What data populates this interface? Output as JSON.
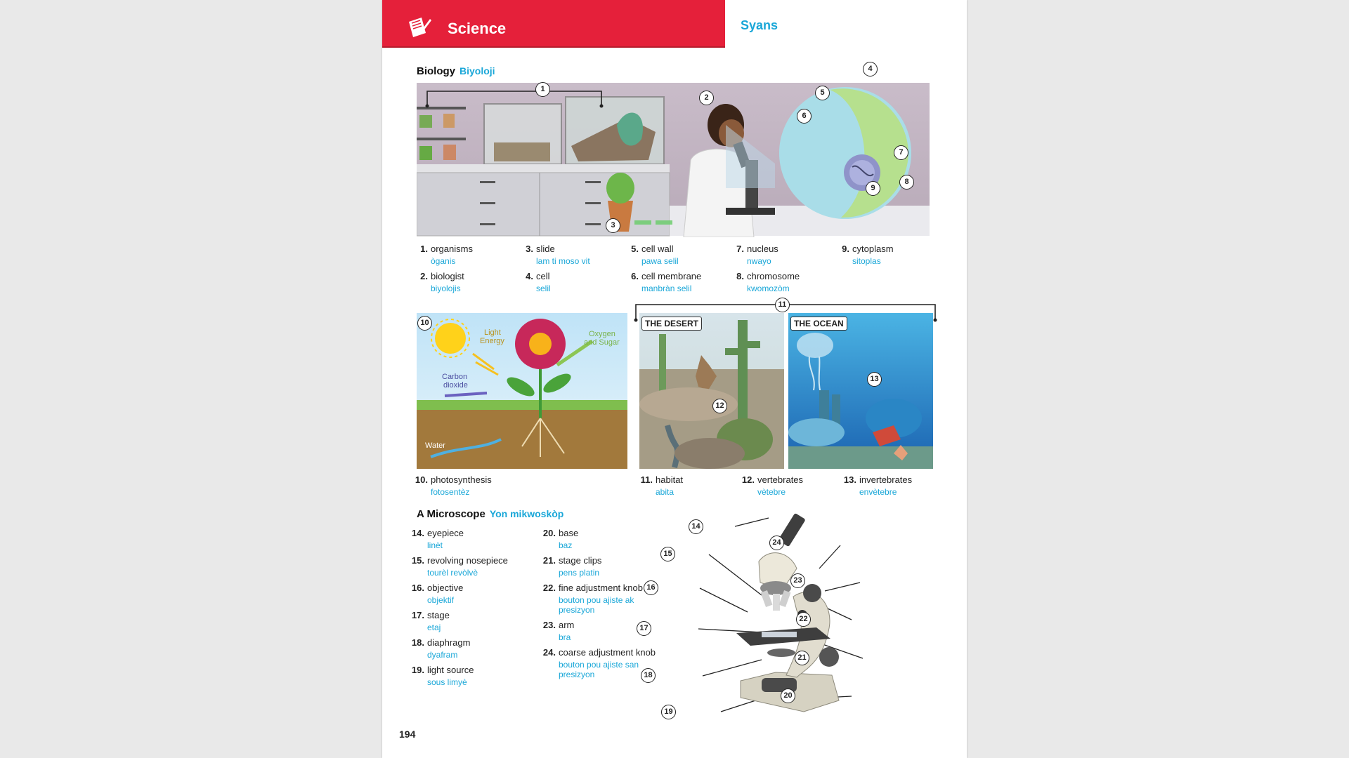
{
  "header": {
    "title": "Science",
    "subtitle": "Syans"
  },
  "biology": {
    "title": "Biology",
    "title_ht": "Biyoloji",
    "items": [
      {
        "num": "1.",
        "en": "organisms",
        "ht": "òganis"
      },
      {
        "num": "2.",
        "en": "biologist",
        "ht": "biyolojis"
      },
      {
        "num": "3.",
        "en": "slide",
        "ht": "lam ti moso vit"
      },
      {
        "num": "4.",
        "en": "cell",
        "ht": "selil"
      },
      {
        "num": "5.",
        "en": "cell wall",
        "ht": "pawa selil"
      },
      {
        "num": "6.",
        "en": "cell membrane",
        "ht": "manbràn selil"
      },
      {
        "num": "7.",
        "en": "nucleus",
        "ht": "nwayo"
      },
      {
        "num": "8.",
        "en": "chromosome",
        "ht": "kwomozòm"
      },
      {
        "num": "9.",
        "en": "cytoplasm",
        "ht": "sitoplas"
      }
    ]
  },
  "ecology": {
    "items": [
      {
        "num": "10.",
        "en": "photosynthesis",
        "ht": "fotosentèz"
      },
      {
        "num": "11.",
        "en": "habitat",
        "ht": "abita"
      },
      {
        "num": "12.",
        "en": "vertebrates",
        "ht": "vètebre"
      },
      {
        "num": "13.",
        "en": "invertebrates",
        "ht": "envètebre"
      }
    ],
    "photo_labels": {
      "light": "Light Energy",
      "oxygen": "Oxygen and Sugar",
      "carbon": "Carbon dioxide",
      "water": "Water"
    },
    "desert_label": "THE DESERT",
    "ocean_label": "THE OCEAN"
  },
  "microscope": {
    "title": "A Microscope",
    "title_ht": "Yon mikwoskòp",
    "items": [
      {
        "num": "14.",
        "en": "eyepiece",
        "ht": "linèt"
      },
      {
        "num": "15.",
        "en": "revolving nosepiece",
        "ht": "tourèl revòlvè"
      },
      {
        "num": "16.",
        "en": "objective",
        "ht": "objektif"
      },
      {
        "num": "17.",
        "en": "stage",
        "ht": "etaj"
      },
      {
        "num": "18.",
        "en": "diaphragm",
        "ht": "dyafram"
      },
      {
        "num": "19.",
        "en": "light source",
        "ht": "sous limyè"
      },
      {
        "num": "20.",
        "en": "base",
        "ht": "baz"
      },
      {
        "num": "21.",
        "en": "stage clips",
        "ht": "pens platin"
      },
      {
        "num": "22.",
        "en": "fine adjustment knob",
        "ht": "bouton pou ajiste ak presizyon"
      },
      {
        "num": "23.",
        "en": "arm",
        "ht": "bra"
      },
      {
        "num": "24.",
        "en": "coarse adjustment knob",
        "ht": "bouton pou ajiste san presizyon"
      }
    ]
  },
  "callouts": [
    "1",
    "2",
    "3",
    "4",
    "5",
    "6",
    "7",
    "8",
    "9",
    "10",
    "11",
    "12",
    "13",
    "14",
    "15",
    "16",
    "17",
    "18",
    "19",
    "20",
    "21",
    "22",
    "23",
    "24"
  ],
  "page_number": "194",
  "colors": {
    "header_red": "#e5203a",
    "accent_blue": "#1aa7d8"
  }
}
